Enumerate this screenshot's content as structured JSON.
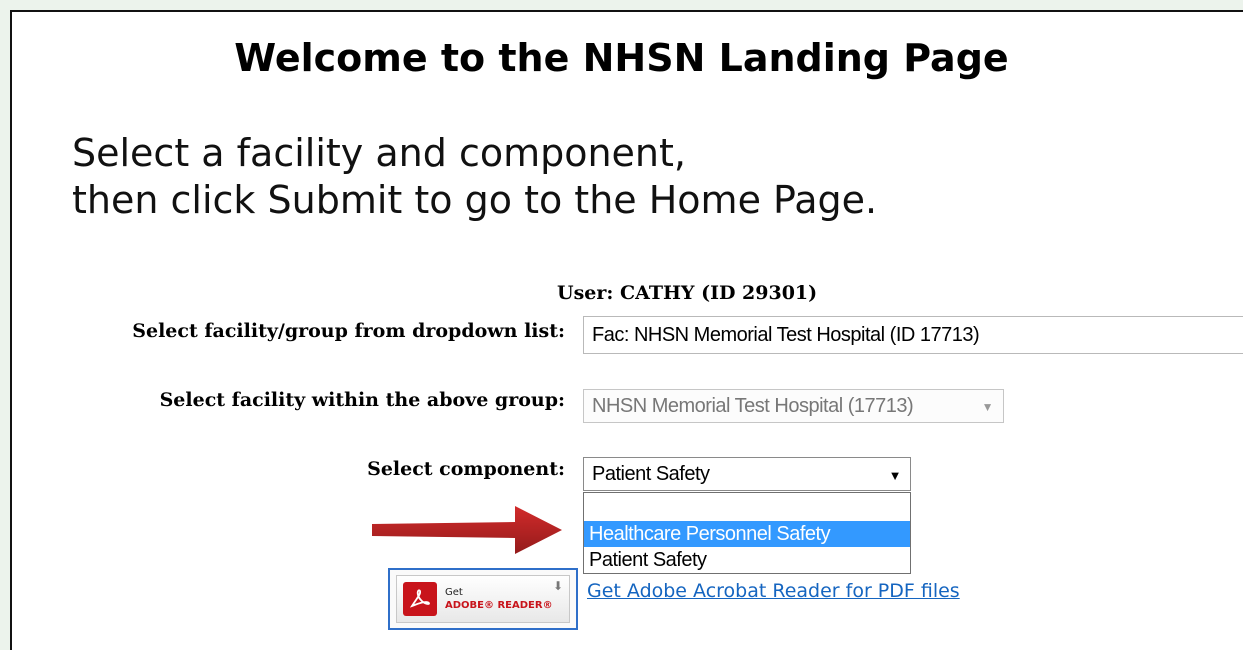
{
  "page": {
    "title": "Welcome to the NHSN Landing Page",
    "instruction_line1": "Select a facility and component,",
    "instruction_line2": "then click Submit to go to the Home Page."
  },
  "user": {
    "text": "User: CATHY (ID 29301)"
  },
  "form": {
    "facility_label": "Select facility/group from dropdown list:",
    "facility_value": "Fac: NHSN Memorial Test Hospital (ID 17713)",
    "within_label": "Select facility within the above group:",
    "within_value": "NHSN Memorial Test Hospital (17713)",
    "component_label": "Select component:",
    "component_value": "Patient Safety",
    "component_options": [
      "",
      "Healthcare Personnel Safety",
      "Patient Safety"
    ],
    "highlighted_option": "Healthcare Personnel Safety"
  },
  "adobe": {
    "badge_get": "Get",
    "badge_brand": "ADOBE® READER®",
    "link_text": "Get Adobe Acrobat Reader for PDF files"
  },
  "colors": {
    "highlight": "#3399ff",
    "arrow": "#b51414",
    "link": "#1565c0",
    "badge_border": "#2f6fc9"
  },
  "icons": {
    "dropdown": "chevron-down-icon",
    "pointer": "red-arrow-icon",
    "pdf": "adobe-pdf-icon",
    "download": "download-icon"
  }
}
